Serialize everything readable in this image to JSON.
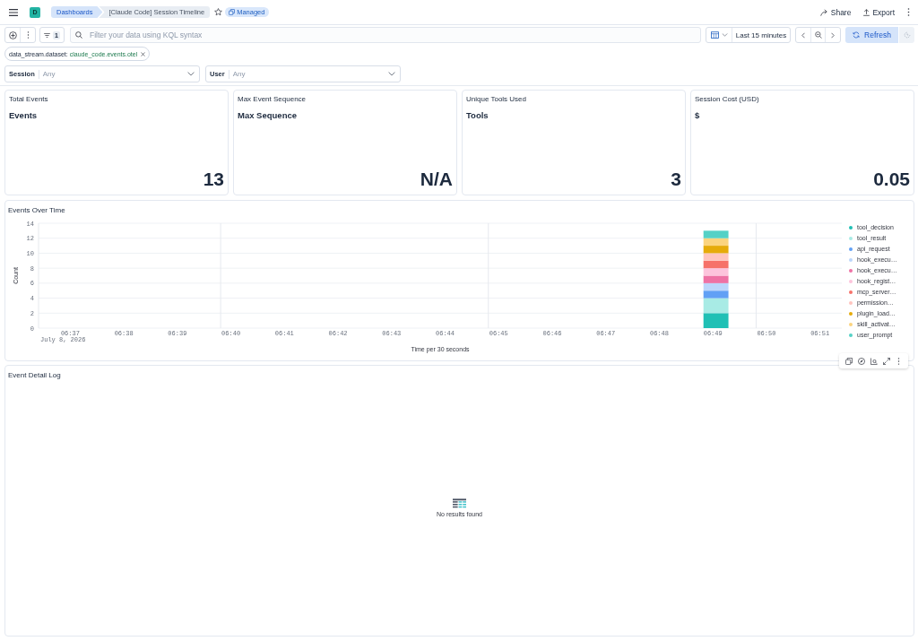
{
  "header": {
    "avatar": "D",
    "breadcrumbs": [
      {
        "label": "Dashboards",
        "current": false
      },
      {
        "label": "[Claude Code] Session Timeline",
        "current": true
      }
    ],
    "favorite": false,
    "badge": "Managed",
    "actions": [
      {
        "kind": "share",
        "label": "Share"
      },
      {
        "kind": "export",
        "label": "Export"
      }
    ]
  },
  "query_bar": {
    "filter_count": "1",
    "search": {
      "placeholder": "Filter your data using KQL syntax"
    },
    "time_range": "Last 15 minutes",
    "refresh": "Refresh"
  },
  "filters": [
    {
      "field": "data_stream.dataset:",
      "value": "claude_code.events.otel"
    }
  ],
  "controls": [
    {
      "label": "Session",
      "placeholder": "Any"
    },
    {
      "label": "User",
      "placeholder": "Any"
    }
  ],
  "metrics": [
    {
      "title": "Total Events",
      "label": "Events",
      "value": "13"
    },
    {
      "title": "Max Event Sequence",
      "label": "Max Sequence",
      "value": "N/A"
    },
    {
      "title": "Unique Tools Used",
      "label": "Tools",
      "value": "3"
    },
    {
      "title": "Session Cost (USD)",
      "label": "$",
      "value": "0.05"
    }
  ],
  "events_panel": {
    "title": "Events Over Time",
    "chart_data": {
      "type": "bar",
      "stacked": true,
      "grid": true,
      "xlabel": "Time per 30 seconds",
      "ylabel": "Count",
      "categories": [
        null,
        "06:37",
        null,
        "06:38",
        null,
        "06:39",
        null,
        "06:40",
        null,
        "06:41",
        null,
        "06:42",
        null,
        "06:43",
        null,
        "06:44",
        null,
        "06:45",
        null,
        "06:46",
        null,
        "06:47",
        null,
        "06:48",
        null,
        "06:49",
        null,
        "06:50",
        null,
        "06:51"
      ],
      "ylim": [
        0,
        14
      ],
      "yticks": [
        0,
        2,
        4,
        6,
        8,
        10,
        12,
        14
      ],
      "annotations": [
        "July 8, 2026"
      ],
      "series": [
        {
          "name": "tool_decision",
          "color": "#20c0b5",
          "values": [
            0,
            0,
            0,
            0,
            0,
            0,
            0,
            0,
            0,
            0,
            0,
            0,
            0,
            0,
            0,
            0,
            0,
            0,
            0,
            0,
            0,
            0,
            0,
            0,
            0,
            2,
            0,
            0,
            0,
            0
          ]
        },
        {
          "name": "tool_result",
          "color": "#a8ebe5",
          "values": [
            0,
            0,
            0,
            0,
            0,
            0,
            0,
            0,
            0,
            0,
            0,
            0,
            0,
            0,
            0,
            0,
            0,
            0,
            0,
            0,
            0,
            0,
            0,
            0,
            0,
            2,
            0,
            0,
            0,
            0
          ]
        },
        {
          "name": "api_request",
          "color": "#61a0f5",
          "values": [
            0,
            0,
            0,
            0,
            0,
            0,
            0,
            0,
            0,
            0,
            0,
            0,
            0,
            0,
            0,
            0,
            0,
            0,
            0,
            0,
            0,
            0,
            0,
            0,
            0,
            1,
            0,
            0,
            0,
            0
          ]
        },
        {
          "name": "hook_execu…",
          "color": "#bcd6fb",
          "values": [
            0,
            0,
            0,
            0,
            0,
            0,
            0,
            0,
            0,
            0,
            0,
            0,
            0,
            0,
            0,
            0,
            0,
            0,
            0,
            0,
            0,
            0,
            0,
            0,
            0,
            1,
            0,
            0,
            0,
            0
          ]
        },
        {
          "name": "hook_execu…",
          "color": "#ee72a5",
          "values": [
            0,
            0,
            0,
            0,
            0,
            0,
            0,
            0,
            0,
            0,
            0,
            0,
            0,
            0,
            0,
            0,
            0,
            0,
            0,
            0,
            0,
            0,
            0,
            0,
            0,
            1,
            0,
            0,
            0,
            0
          ]
        },
        {
          "name": "hook_regist…",
          "color": "#fdc4dc",
          "values": [
            0,
            0,
            0,
            0,
            0,
            0,
            0,
            0,
            0,
            0,
            0,
            0,
            0,
            0,
            0,
            0,
            0,
            0,
            0,
            0,
            0,
            0,
            0,
            0,
            0,
            1,
            0,
            0,
            0,
            0
          ]
        },
        {
          "name": "mcp_server…",
          "color": "#f6726a",
          "values": [
            0,
            0,
            0,
            0,
            0,
            0,
            0,
            0,
            0,
            0,
            0,
            0,
            0,
            0,
            0,
            0,
            0,
            0,
            0,
            0,
            0,
            0,
            0,
            0,
            0,
            1,
            0,
            0,
            0,
            0
          ]
        },
        {
          "name": "permission…",
          "color": "#ffc5be",
          "values": [
            0,
            0,
            0,
            0,
            0,
            0,
            0,
            0,
            0,
            0,
            0,
            0,
            0,
            0,
            0,
            0,
            0,
            0,
            0,
            0,
            0,
            0,
            0,
            0,
            0,
            1,
            0,
            0,
            0,
            0
          ]
        },
        {
          "name": "plugin_load…",
          "color": "#e6ab0a",
          "values": [
            0,
            0,
            0,
            0,
            0,
            0,
            0,
            0,
            0,
            0,
            0,
            0,
            0,
            0,
            0,
            0,
            0,
            0,
            0,
            0,
            0,
            0,
            0,
            0,
            0,
            1,
            0,
            0,
            0,
            0
          ]
        },
        {
          "name": "skill_activat…",
          "color": "#fbd47f",
          "values": [
            0,
            0,
            0,
            0,
            0,
            0,
            0,
            0,
            0,
            0,
            0,
            0,
            0,
            0,
            0,
            0,
            0,
            0,
            0,
            0,
            0,
            0,
            0,
            0,
            0,
            1,
            0,
            0,
            0,
            0
          ]
        },
        {
          "name": "user_prompt",
          "color": "#54d1c6",
          "values": [
            0,
            0,
            0,
            0,
            0,
            0,
            0,
            0,
            0,
            0,
            0,
            0,
            0,
            0,
            0,
            0,
            0,
            0,
            0,
            0,
            0,
            0,
            0,
            0,
            0,
            1,
            0,
            0,
            0,
            0
          ]
        }
      ]
    }
  },
  "log_panel": {
    "title": "Event Detail Log",
    "empty_message": "No results found"
  }
}
